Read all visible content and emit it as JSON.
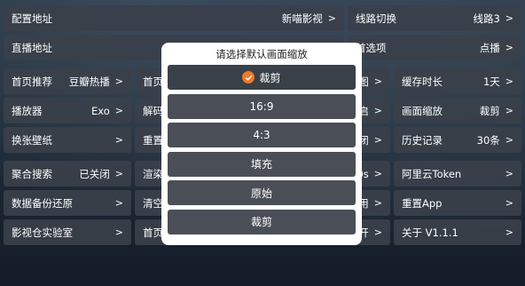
{
  "rows": [
    {
      "tiles": [
        {
          "label": "配置地址",
          "value": "新喵影视"
        },
        {
          "label": "线路切换",
          "value": "线路3"
        }
      ]
    },
    {
      "tiles": [
        {
          "label": "直播地址",
          "value": ""
        },
        {
          "label": "首选项",
          "value": "点播"
        }
      ]
    },
    {
      "tiles": [
        {
          "label": "首页推荐",
          "value": "豆瓣热播"
        },
        {
          "label": "首页",
          "value": ""
        },
        {
          "label": "图",
          "value": ""
        },
        {
          "label": "缓存时长",
          "value": "1天"
        }
      ]
    },
    {
      "tiles": [
        {
          "label": "播放器",
          "value": "Exo"
        },
        {
          "label": "解码",
          "value": ""
        },
        {
          "label": "启",
          "value": ""
        },
        {
          "label": "画面缩放",
          "value": "裁剪"
        }
      ]
    },
    {
      "tiles": [
        {
          "label": "换张壁纸",
          "value": ""
        },
        {
          "label": "重置",
          "value": ""
        },
        {
          "label": "闭",
          "value": ""
        },
        {
          "label": "历史记录",
          "value": "30条"
        }
      ]
    },
    {
      "tiles": [
        {
          "label": "聚合搜索",
          "value": "已关闭"
        },
        {
          "label": "渲染",
          "value": ""
        },
        {
          "label": "0s",
          "value": ""
        },
        {
          "label": "阿里云Token",
          "value": ""
        }
      ]
    },
    {
      "tiles": [
        {
          "label": "数据备份还原",
          "value": ""
        },
        {
          "label": "清空",
          "value": ""
        },
        {
          "label": "用",
          "value": ""
        },
        {
          "label": "重置App",
          "value": ""
        }
      ]
    },
    {
      "tiles": [
        {
          "label": "影视仓实验室",
          "value": ""
        },
        {
          "label": "首页",
          "value": ""
        },
        {
          "label": "开",
          "value": ""
        },
        {
          "label": "关于  V1.1.1",
          "value": ""
        }
      ]
    }
  ],
  "chevron": ">",
  "modal": {
    "title": "请选择默认画面缩放",
    "options": [
      "裁剪",
      "16:9",
      "4:3",
      "填充",
      "原始",
      "裁剪"
    ],
    "selected_index": 0
  },
  "colors": {
    "accent": "#f07a28",
    "tile": "#3a404a",
    "option": "#4a4f57"
  }
}
